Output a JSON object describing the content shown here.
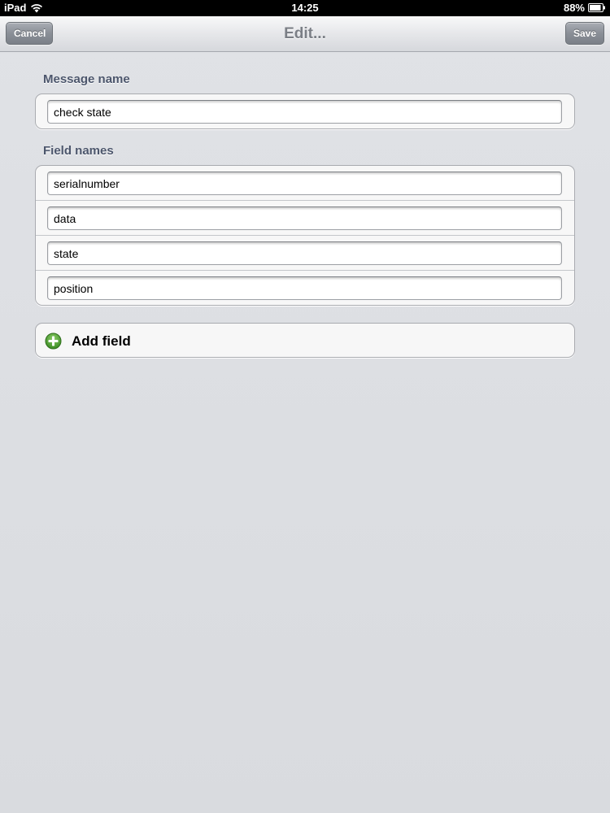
{
  "status_bar": {
    "device": "iPad",
    "time": "14:25",
    "battery": "88%"
  },
  "nav_bar": {
    "title": "Edit...",
    "cancel_label": "Cancel",
    "save_label": "Save"
  },
  "message_section": {
    "header": "Message name",
    "value": "check state"
  },
  "fields_section": {
    "header": "Field names",
    "fields": [
      "serialnumber",
      "data",
      "state",
      "position"
    ]
  },
  "add_field": {
    "label": "Add field",
    "icon": "plus-circle-icon",
    "icon_color": "#4a9a2c"
  }
}
